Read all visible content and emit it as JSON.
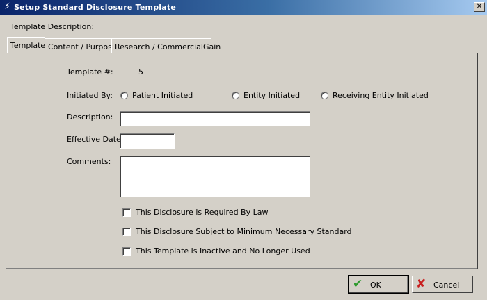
{
  "window": {
    "title": "Setup Standard Disclosure Template",
    "close_glyph": "✕"
  },
  "template_description_label": "Template Description:",
  "tabs": [
    {
      "label": "Template"
    },
    {
      "label": "Content / Purpose"
    },
    {
      "label": "Research / CommercialGain"
    }
  ],
  "form": {
    "template_no_label": "Template #:",
    "template_no_value": "5",
    "initiated_by_label": "Initiated By:",
    "initiated_options": [
      "Patient Initiated",
      "Entity Initiated",
      "Receiving Entity Initiated"
    ],
    "description_label": "Description:",
    "description_value": "",
    "effective_date_label": "Effective Date:",
    "effective_date_value": "",
    "comments_label": "Comments:",
    "comments_value": "",
    "checkboxes": [
      "This Disclosure is Required By Law",
      "This Disclosure Subject to Minimum Necessary Standard",
      "This Template is Inactive and No Longer Used"
    ]
  },
  "buttons": {
    "ok_label": "OK",
    "cancel_label": "Cancel"
  },
  "icons": {
    "ok": "checkmark-icon",
    "cancel": "x-icon",
    "app": "app-icon"
  },
  "colors": {
    "title_start": "#0a246a",
    "title_end": "#a6caf0",
    "ok_green": "#2e9a2e",
    "cancel_red": "#c81e1e"
  }
}
